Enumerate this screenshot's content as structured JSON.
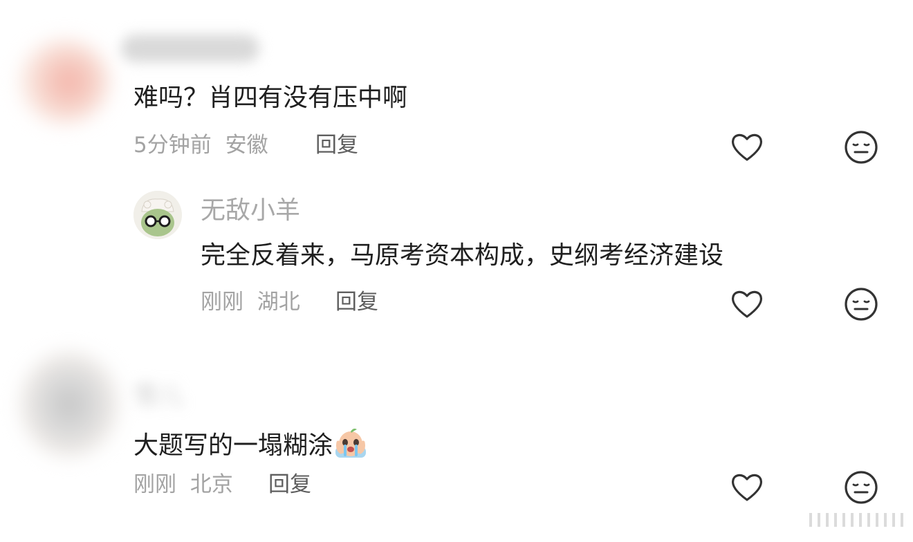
{
  "comments": [
    {
      "content": "难吗？肖四有没有压中啊",
      "time": "5分钟前",
      "location": "安徽",
      "reply_label": "回复"
    },
    {
      "username": "无敌小羊",
      "content": "完全反着来，马原考资本构成，史纲考经济建设",
      "time": "刚刚",
      "location": "湖北",
      "reply_label": "回复"
    },
    {
      "username": "雪儿",
      "content": "大题写的一塌糊涂",
      "time": "刚刚",
      "location": "北京",
      "reply_label": "回复"
    }
  ],
  "colors": {
    "text": "#1f1f1f",
    "meta": "#a3a3a3",
    "reply": "#5e5e5e",
    "icon": "#333333"
  },
  "icons": {
    "like": "heart-icon",
    "dislike": "meh-face-icon"
  }
}
